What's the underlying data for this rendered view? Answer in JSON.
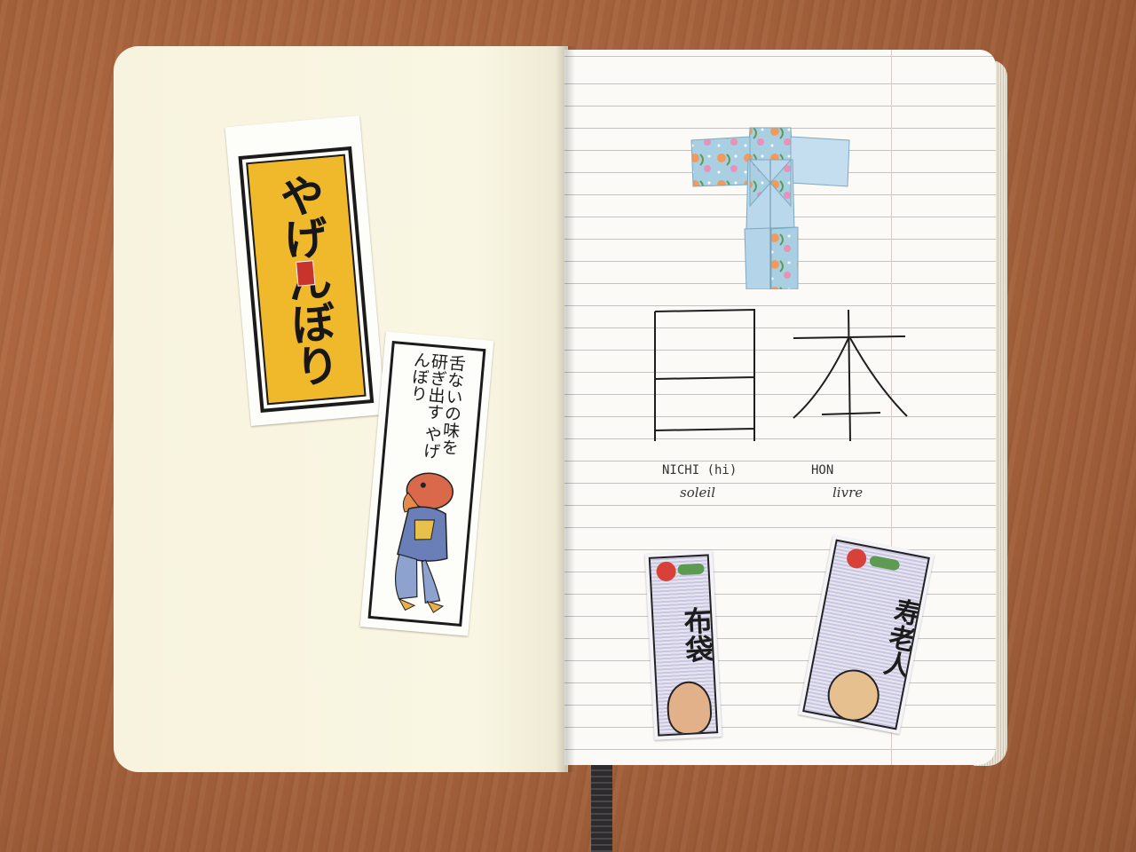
{
  "scene": {
    "description_free": true,
    "colors": {
      "table": "#a8663f",
      "paper_left": "#f9f6e3",
      "paper_right": "#fbfaf6",
      "sticker_yellow": "#f0b92b",
      "origami_blue": "#a9cfe3"
    }
  },
  "left_page": {
    "sticker_large_text": "やげんぼり",
    "sticker_small_caption": "舌ないの味を研ぎ出す やげんぼり"
  },
  "right_page": {
    "kanji": [
      {
        "reading": "NICHI (hi)",
        "meaning": "soleil"
      },
      {
        "reading": "HON",
        "meaning": "livre"
      }
    ],
    "sticker_a_text": "布袋",
    "sticker_b_text": "寿老人",
    "origami": "kimono"
  }
}
